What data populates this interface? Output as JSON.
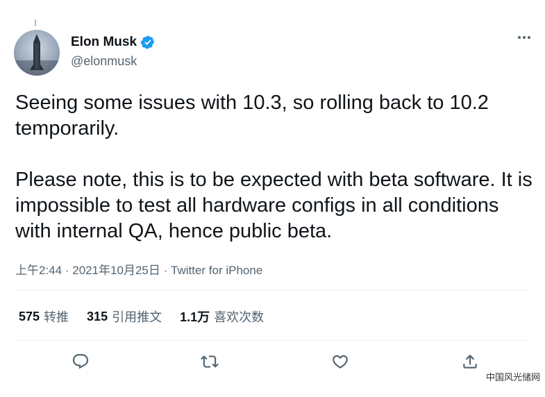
{
  "user": {
    "name": "Elon Musk",
    "handle": "@elonmusk"
  },
  "tweet": {
    "paragraphs": [
      "Seeing some issues with 10.3, so rolling back to 10.2 temporarily.",
      "Please note, this is to be expected with beta software. It is impossible to test all hardware configs in all conditions with internal QA, hence public beta."
    ],
    "time": "上午2:44",
    "separator": "·",
    "date": "2021年10月25日",
    "source": "Twitter for iPhone"
  },
  "stats": {
    "retweets_count": "575",
    "retweets_label": "转推",
    "quotes_count": "315",
    "quotes_label": "引用推文",
    "likes_count": "1.1万",
    "likes_label": "喜欢次数"
  },
  "icons": {
    "verified": "verified-badge-icon",
    "more": "more-horizontal-icon",
    "reply": "reply-icon",
    "retweet": "retweet-icon",
    "like": "heart-icon",
    "share": "share-icon"
  },
  "colors": {
    "verified": "#1d9bf0",
    "text_primary": "#0f1419",
    "text_secondary": "#536471",
    "divider": "#eff3f4"
  },
  "watermark": "中国风光储网"
}
